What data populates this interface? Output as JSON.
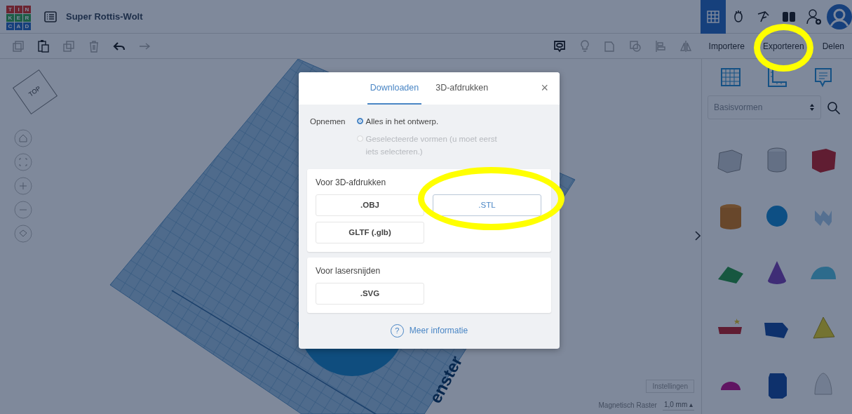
{
  "app": {
    "logo_letters": [
      "T",
      "I",
      "N",
      "K",
      "E",
      "R",
      "C",
      "A",
      "D"
    ],
    "design_title": "Super Rottis-Wolt"
  },
  "views": [
    {
      "selected": true
    },
    {
      "selected": false
    },
    {
      "selected": false
    },
    {
      "selected": false
    }
  ],
  "toolbar_actions": [
    "Importere",
    "Exporteren",
    "Delen"
  ],
  "view_cube": {
    "label": "TOP"
  },
  "workplane": {
    "label": "enster"
  },
  "dialog": {
    "tabs": [
      {
        "label": "Downloaden",
        "selected": true
      },
      {
        "label": "3D-afdrukken",
        "selected": false
      }
    ],
    "close": "×",
    "include_label": "Opnemen",
    "include_options": [
      {
        "label": "Alles in het ontwerp.",
        "selected": true,
        "disabled": false
      },
      {
        "label": "Geselecteerde vormen (u moet eerst iets selecteren.)",
        "selected": false,
        "disabled": true
      }
    ],
    "sections": [
      {
        "title": "Voor 3D-afdrukken",
        "formats": [
          {
            "label": ".OBJ",
            "selected": false
          },
          {
            "label": ".STL",
            "selected": true
          },
          {
            "label": "GLTF (.glb)",
            "selected": false
          }
        ]
      },
      {
        "title": "Voor lasersnijden",
        "formats": [
          {
            "label": ".SVG",
            "selected": false
          }
        ]
      }
    ],
    "help_glyph": "?",
    "more_info": "Meer informatie"
  },
  "shapes_panel": {
    "category": "Basisvormen"
  },
  "settings_button": "Instellingen",
  "snap_grid": {
    "label": "Magnetisch Raster",
    "value": "1,0 mm ▴"
  }
}
